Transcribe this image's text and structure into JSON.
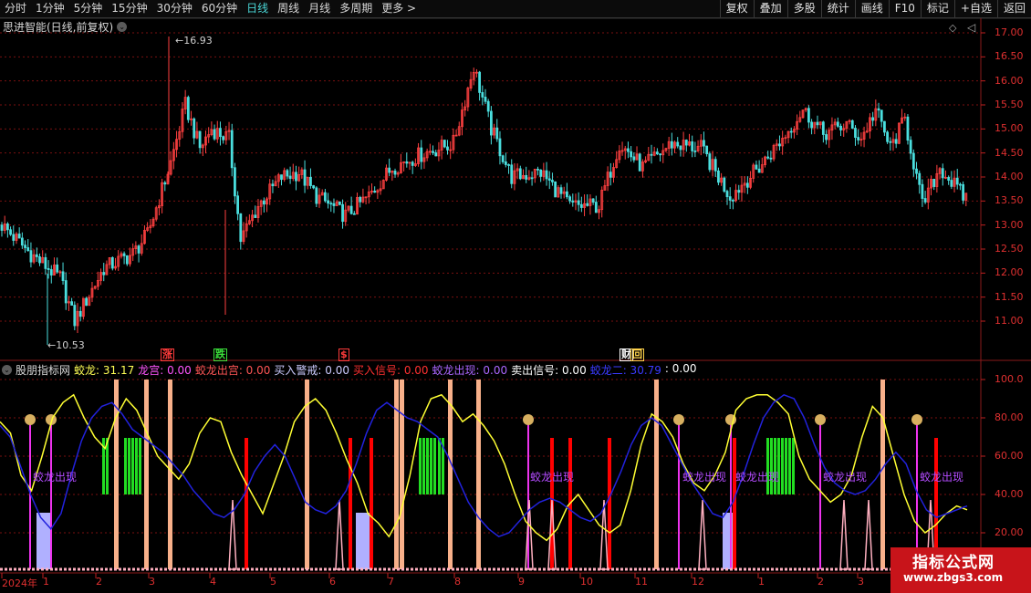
{
  "toolbar": {
    "periods": [
      "分时",
      "1分钟",
      "5分钟",
      "15分钟",
      "30分钟",
      "60分钟",
      "日线",
      "周线",
      "月线",
      "多周期",
      "更多"
    ],
    "more_arrow": ">",
    "right_buttons": [
      "复权",
      "叠加",
      "多股",
      "统计",
      "画线",
      "F10",
      "标记",
      "+自选",
      "返回"
    ]
  },
  "main_panel": {
    "title": "思进智能(日线,前复权)",
    "high_label": "16.93",
    "low_label": "10.53",
    "y_ticks": [
      "17.00",
      "16.50",
      "16.00",
      "15.50",
      "15.00",
      "14.50",
      "14.00",
      "13.50",
      "13.00",
      "12.50",
      "12.00",
      "11.50",
      "11.00"
    ],
    "events": [
      {
        "text": "涨",
        "color": "#ff3b3b"
      },
      {
        "text": "跌",
        "color": "#3be03b"
      },
      {
        "text": "$",
        "color": "#ff3b3b"
      },
      {
        "text": "财",
        "color": "#ffffff"
      },
      {
        "text": "回",
        "color": "#ffd24a"
      }
    ],
    "colors": {
      "up": "#ff4040",
      "down": "#4adede",
      "grid": "#7a1010"
    }
  },
  "indicator_panel": {
    "name": "股朋指标网",
    "fields": [
      {
        "label": "蛟龙:",
        "value": "31.17",
        "color": "#ffff55"
      },
      {
        "label": "龙宫:",
        "value": "0.00",
        "color": "#ff55ff"
      },
      {
        "label": "蛟龙出宫:",
        "value": "0.00",
        "color": "#ff5555"
      },
      {
        "label": "买入警戒:",
        "value": "0.00",
        "color": "#ccccff"
      },
      {
        "label": "买入信号:",
        "value": "0.00",
        "color": "#ff3030"
      },
      {
        "label": "蛟龙出现:",
        "value": "0.00",
        "color": "#aa66ff"
      },
      {
        "label": "卖出信号:",
        "value": "0.00",
        "color": "#ffffff"
      },
      {
        "label": "蛟龙二:",
        "value": "30.79",
        "color": "#3a3aff"
      },
      {
        "label": ":",
        "value": "0.00",
        "color": "#ffffff"
      }
    ],
    "y_ticks": [
      "100.0",
      "80.00",
      "60.00",
      "40.00",
      "20.00"
    ],
    "signal_text": "蛟龙出现",
    "colors": {
      "line1": "#ffff33",
      "line2": "#2222dd",
      "green_box": "#22dd22",
      "orange_bar": "#f8b08a",
      "red_spike": "#ff0000",
      "magenta": "#ee33ee",
      "lavender": "#b0b0ff",
      "pink": "#ffb0c0"
    }
  },
  "x_axis": {
    "labels": [
      "2024年",
      "1",
      "2",
      "3",
      "4",
      "5",
      "6",
      "7",
      "8",
      "9",
      "10",
      "11",
      "12",
      "1",
      "2",
      "3"
    ]
  },
  "watermark": {
    "line1": "指标公式网",
    "line2": "www.zbgs3.com"
  }
}
